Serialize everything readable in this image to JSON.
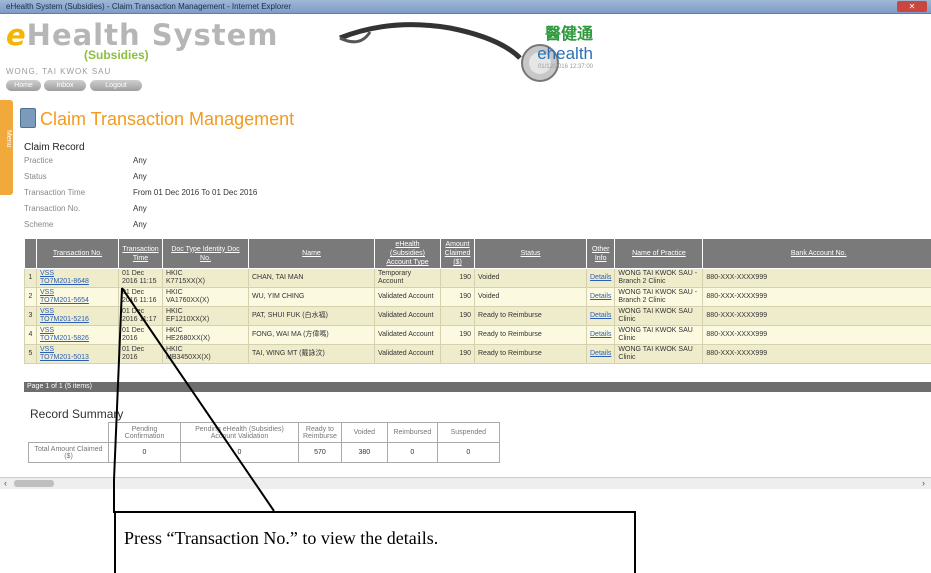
{
  "window": {
    "title": "eHealth System (Subsidies) - Claim Transaction Management - Internet Explorer"
  },
  "header": {
    "logo_main": "Health System",
    "logo_e": "e",
    "logo_sub": "(Subsidies)",
    "user": "WONG, TAI KWOK SAU",
    "buttons": [
      "Home",
      "Inbox",
      "Logout"
    ],
    "ehealth_cn": "醫健通",
    "ehealth_en": "ehealth",
    "datetime": "01/12/2016 12:37:00"
  },
  "sidemenu": {
    "label": "Menu"
  },
  "page": {
    "title": "Claim Transaction Management"
  },
  "claim_record": {
    "heading": "Claim Record",
    "fields": [
      {
        "label": "Practice",
        "value": "Any"
      },
      {
        "label": "Status",
        "value": "Any"
      },
      {
        "label": "Transaction Time",
        "value": "From 01 Dec 2016 To 01 Dec 2016"
      },
      {
        "label": "Transaction No.",
        "value": "Any"
      },
      {
        "label": "Scheme",
        "value": "Any"
      }
    ]
  },
  "table": {
    "headers": [
      "",
      "Transaction No.",
      "Transaction Time",
      "Doc Type Identity Doc No.",
      "Name",
      "eHealth (Subsidies) Account Type",
      "Amount Claimed ($)",
      "Status",
      "Other Info",
      "Name of Practice",
      "Bank Account No."
    ],
    "rows": [
      {
        "no": "1",
        "scheme": "VSS",
        "txn": "TO7M201-8648",
        "time": "01 Dec 2016 11:15",
        "doc": "HKIC",
        "docno": "K7715XX(X)",
        "name": "CHAN, TAI MAN",
        "account": "Temporary Account",
        "amount": "190",
        "status": "Voided",
        "info": "Details",
        "practice": "WONG TAI KWOK SAU - Branch 2 Clinic",
        "bank": "880-XXX-XXXX999"
      },
      {
        "no": "2",
        "scheme": "VSS",
        "txn": "TO7M201-5654",
        "time": "01 Dec 2016 11:16",
        "doc": "HKIC",
        "docno": "VA1760XX(X)",
        "name": "WU, YIM CHING",
        "account": "Validated Account",
        "amount": "190",
        "status": "Voided",
        "info": "Details",
        "practice": "WONG TAI KWOK SAU - Branch 2 Clinic",
        "bank": "880-XXX-XXXX999"
      },
      {
        "no": "3",
        "scheme": "VSS",
        "txn": "TO7M201-5216",
        "time": "01 Dec 2016 11:17",
        "doc": "HKIC",
        "docno": "EF1210XX(X)",
        "name": "PAT, SHUI FUK (白水福)",
        "account": "Validated Account",
        "amount": "190",
        "status": "Ready to Reimburse",
        "info": "Details",
        "practice": "WONG TAI KWOK SAU Clinic",
        "bank": "880-XXX-XXXX999"
      },
      {
        "no": "4",
        "scheme": "VSS",
        "txn": "TO7M201-5826",
        "time": "01 Dec 2016",
        "doc": "HKIC",
        "docno": "HE2680XX(X)",
        "name": "FONG, WAI MA (方偉嗎)",
        "account": "Validated Account",
        "amount": "190",
        "status": "Ready to Reimburse",
        "info": "Details",
        "practice": "WONG TAI KWOK SAU Clinic",
        "bank": "880-XXX-XXXX999"
      },
      {
        "no": "5",
        "scheme": "VSS",
        "txn": "TO7M201-5013",
        "time": "01 Dec 2016",
        "doc": "HKIC",
        "docno": "MB3450XX(X)",
        "name": "TAI, WING MT (戴詠汶)",
        "account": "Validated Account",
        "amount": "190",
        "status": "Ready to Reimburse",
        "info": "Details",
        "practice": "WONG TAI KWOK SAU Clinic",
        "bank": "880-XXX-XXXX999"
      }
    ],
    "pager": "Page 1 of 1 (5 items)"
  },
  "summary": {
    "title": "Record Summary",
    "headers": [
      "Pending Confirmation",
      "Pending eHealth (Subsidies) Account Validation",
      "Ready to Reimburse",
      "Voided",
      "Reimbursed",
      "Suspended"
    ],
    "row_label": "Total Amount Claimed ($)",
    "values": [
      "0",
      "0",
      "570",
      "380",
      "0",
      "0"
    ]
  },
  "callout": {
    "text": "Press “Transaction No.” to view the details."
  }
}
